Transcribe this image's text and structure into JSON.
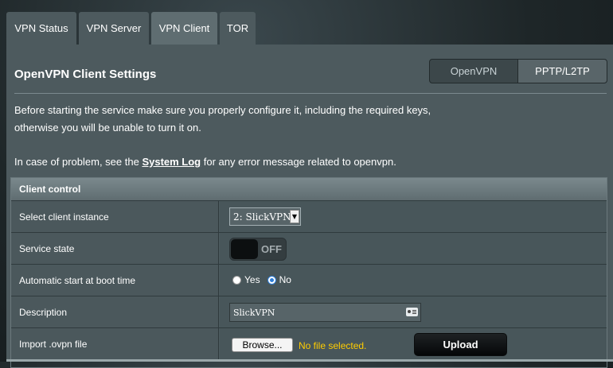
{
  "tabs": [
    {
      "label": "VPN Status"
    },
    {
      "label": "VPN Server"
    },
    {
      "label": "VPN Client",
      "active": true
    },
    {
      "label": "TOR"
    }
  ],
  "panel": {
    "title": "OpenVPN Client Settings",
    "mode_toggle": {
      "options": [
        "OpenVPN",
        "PPTP/L2TP"
      ],
      "selected": "OpenVPN"
    },
    "intro": {
      "line1": "Before starting the service make sure you properly configure it, including the required keys,",
      "line2": "otherwise you will be unable to turn it on.",
      "line3_pre": "In case of problem, see the ",
      "line3_link": "System Log",
      "line3_post": " for any error message related to openvpn."
    }
  },
  "client_control": {
    "header": "Client control",
    "rows": {
      "instance": {
        "label": "Select client instance",
        "value": "2: SlickVPN"
      },
      "service_state": {
        "label": "Service state",
        "value": "OFF"
      },
      "autostart": {
        "label": "Automatic start at boot time",
        "options": [
          "Yes",
          "No"
        ],
        "selected": "No"
      },
      "description": {
        "label": "Description",
        "value": "SlickVPN"
      },
      "import": {
        "label": "Import .ovpn file",
        "browse_label": "Browse...",
        "file_status": "No file selected.",
        "upload_label": "Upload"
      }
    }
  },
  "icons": {
    "select_arrow": "chevron-down-icon",
    "description_field": "contact-card-icon"
  },
  "colors": {
    "panel_bg": "#4d5a5e",
    "file_status": "#ffcc00",
    "radio_selected": "#2d7dd6"
  }
}
